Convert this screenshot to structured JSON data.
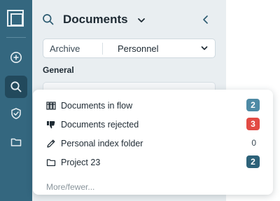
{
  "colors": {
    "rail_bg": "#34677f",
    "rail_active": "#22495c",
    "panel_bg": "#e9eef1",
    "badge_blue_light": "#4e8aa5",
    "badge_red": "#e24b44",
    "badge_blue_dark": "#2d6279"
  },
  "rail": {
    "items": [
      {
        "icon": "logo-icon"
      },
      {
        "icon": "plus-circle-icon"
      },
      {
        "icon": "search-icon",
        "active": true
      },
      {
        "icon": "shield-icon"
      },
      {
        "icon": "folder-icon"
      }
    ]
  },
  "panel": {
    "title": "Documents",
    "filter": {
      "label": "Archive",
      "value": "Personnel"
    },
    "section_label": "General"
  },
  "menu": {
    "items": [
      {
        "label": "Documents in flow",
        "icon": "binder-icon",
        "count": "2",
        "badge_color": "#4e8aa5"
      },
      {
        "label": "Documents rejected",
        "icon": "thumbs-down-icon",
        "count": "3",
        "badge_color": "#e24b44"
      },
      {
        "label": "Personal index folder",
        "icon": "pencil-icon",
        "count": "0",
        "badge_color": ""
      },
      {
        "label": "Project 23",
        "icon": "folder-icon",
        "count": "2",
        "badge_color": "#2d6279"
      }
    ],
    "more_label": "More/fewer..."
  }
}
